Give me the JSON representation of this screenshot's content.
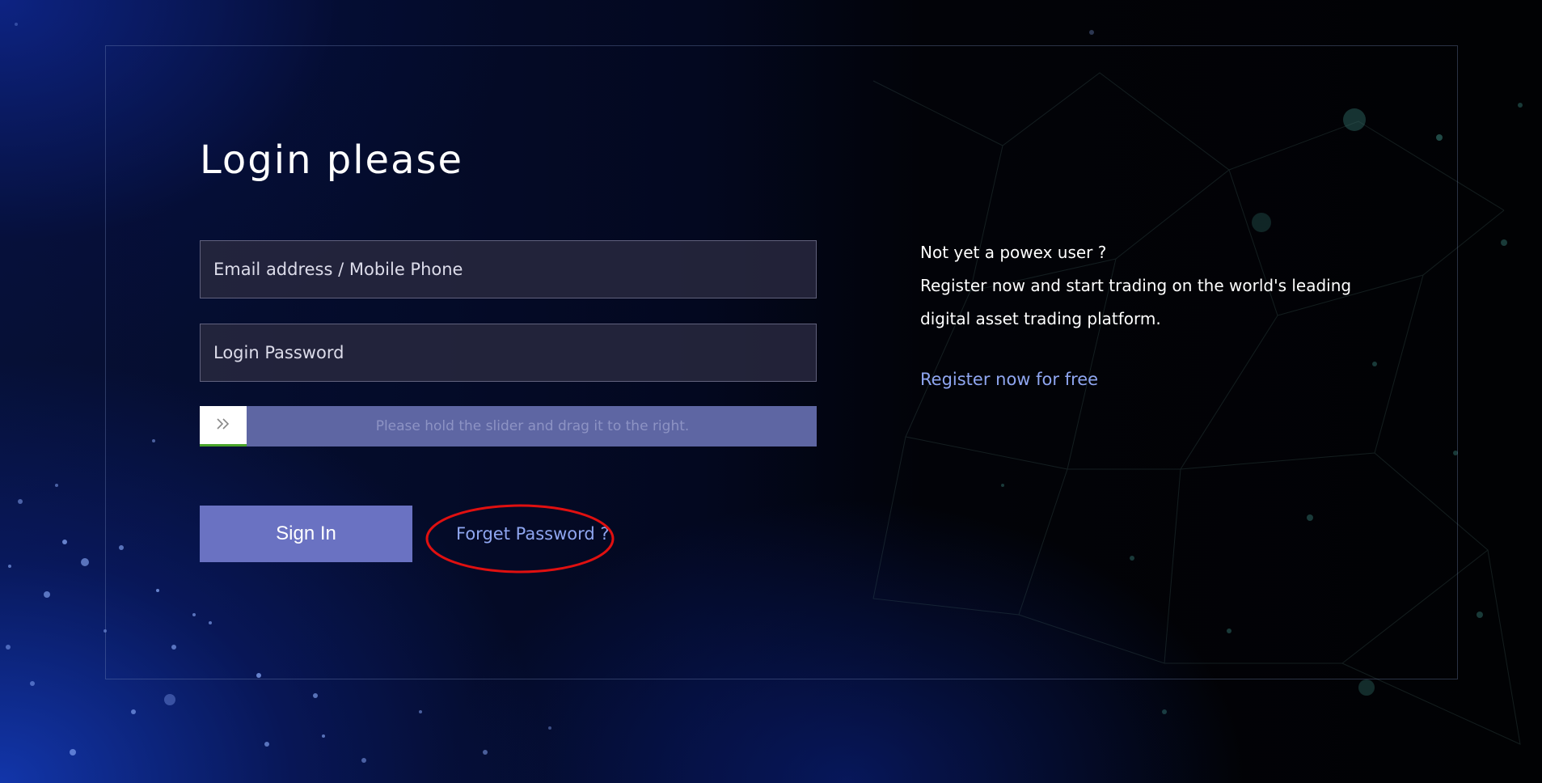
{
  "login": {
    "title": "Login please",
    "email_placeholder": "Email address / Mobile Phone",
    "password_placeholder": "Login Password",
    "slider_hint": "Please hold the slider and drag it to the right.",
    "slider_icon": "double-chevron-right-icon",
    "signin_label": "Sign In",
    "forget_label": "Forget Password ?"
  },
  "promo": {
    "line1": "Not yet a powex user ?",
    "line2": "Register now and start trading on the world's leading",
    "line3": "digital asset trading platform.",
    "register_label": "Register now for free"
  },
  "colors": {
    "accent_button": "#6a72c2",
    "link": "#8fa6f0",
    "slider_track": "#5e66a3",
    "highlight_ring": "#e01010"
  }
}
